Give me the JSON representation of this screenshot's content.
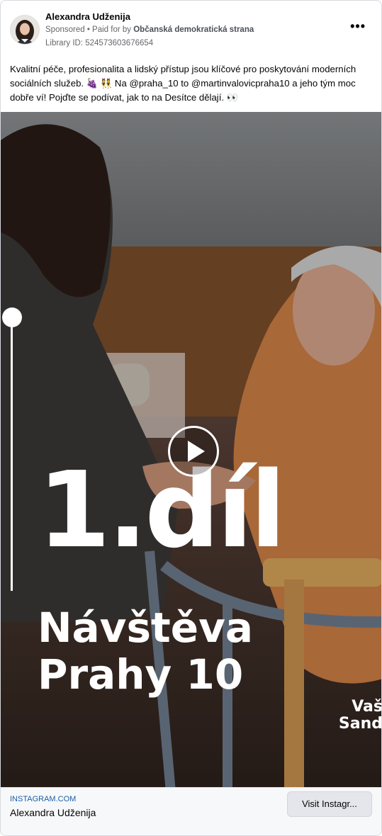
{
  "post": {
    "author_name": "Alexandra Udženija",
    "sponsored_label": "Sponsored",
    "paid_prefix": " • Paid for by ",
    "payer": "Občanská demokratická strana",
    "library_id": "Library ID: 524573603676654",
    "more_label": "•••",
    "text": "Kvalitní péče, profesionalita a lidský přístup jsou klíčové pro poskytování moderních sociálních služeb. 🍇 👯 Na @praha_10 to @martinvalovicpraha10 a jeho tým moc dobře ví! Pojďte se podívat, jak to na Desítce dělají. 👀"
  },
  "video": {
    "title": "1.díl",
    "subtitle_line1": "Návštěva",
    "subtitle_line2": "Prahy 10",
    "watermark_line1": "Vaš",
    "watermark_line2": "Sand"
  },
  "footer": {
    "domain": "INSTAGRAM.COM",
    "name": "Alexandra Udženija",
    "cta_label": "Visit Instagr..."
  },
  "icons": [
    "avatar-photo",
    "more-options-icon",
    "play-icon",
    "timeline-marker"
  ],
  "colors": {
    "link_blue": "#1a5fa8",
    "meta_gray": "#65676b",
    "button_gray": "#e4e6eb"
  }
}
